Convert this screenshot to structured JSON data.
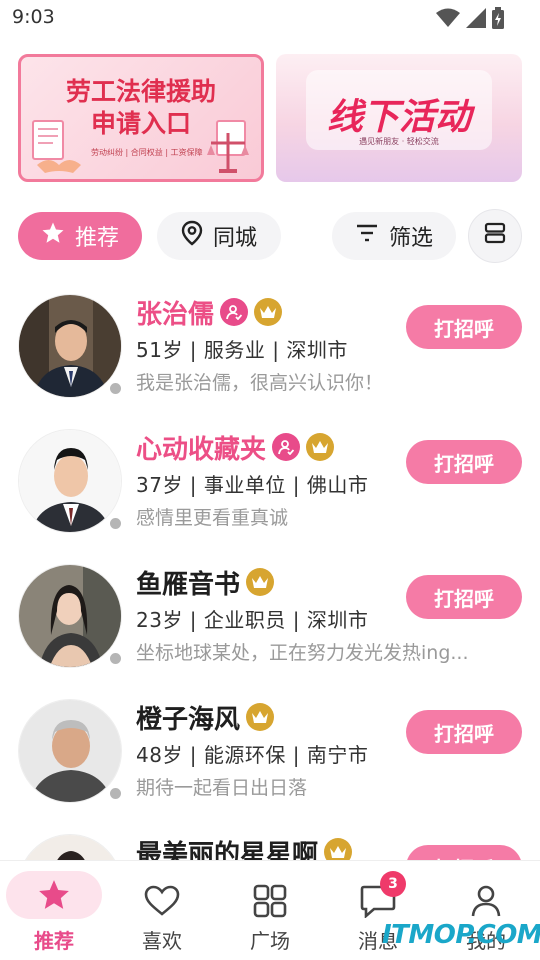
{
  "status_bar": {
    "time": "9:03",
    "icons": [
      "wifi-icon",
      "signal-icon",
      "battery-icon"
    ]
  },
  "banners": [
    {
      "title_line1": "劳工法律援助",
      "title_line2": "申请入口",
      "subtitle": "劳动纠纷 | 合同权益 | 工资保障"
    },
    {
      "title": "线下活动",
      "subtitle": "遇见新朋友 · 轻松交流"
    }
  ],
  "filters": {
    "recommend": "推荐",
    "city": "同城",
    "filter": "筛选"
  },
  "users": [
    {
      "name": "张治儒",
      "info": "51岁 | 服务业 | 深圳市",
      "bio": "我是张治儒，很高兴认识你！",
      "greet": "打招呼",
      "vip_name": true,
      "badges": [
        "verified-user-icon",
        "crown-icon"
      ]
    },
    {
      "name": "心动收藏夹",
      "info": "37岁 | 事业单位 | 佛山市",
      "bio": "感情里更看重真诚",
      "greet": "打招呼",
      "vip_name": true,
      "badges": [
        "verified-user-icon",
        "crown-icon"
      ]
    },
    {
      "name": "鱼雁音书",
      "info": "23岁 | 企业职员 | 深圳市",
      "bio": "坐标地球某处，正在努力发光发热ing...",
      "greet": "打招呼",
      "vip_name": false,
      "badges": [
        "crown-icon"
      ]
    },
    {
      "name": "橙子海风",
      "info": "48岁 | 能源环保 | 南宁市",
      "bio": "期待一起看日出日落",
      "greet": "打招呼",
      "vip_name": false,
      "badges": [
        "crown-icon"
      ]
    },
    {
      "name": "最美丽的星星啊",
      "info": "",
      "bio": "",
      "greet": "打招呼",
      "vip_name": false,
      "badges": [
        "crown-icon"
      ]
    }
  ],
  "tabs": [
    {
      "label": "推荐",
      "icon": "star-icon",
      "active": true
    },
    {
      "label": "喜欢",
      "icon": "heart-icon",
      "active": false
    },
    {
      "label": "广场",
      "icon": "grid-icon",
      "active": false
    },
    {
      "label": "消息",
      "icon": "message-icon",
      "active": false,
      "badge": "3"
    },
    {
      "label": "我的",
      "icon": "person-icon",
      "active": false
    }
  ],
  "watermark": "ITMOP.COM",
  "colors": {
    "accent": "#f06d9d",
    "vip_name": "#ec4f86",
    "crown": "#d7a530",
    "badge_red": "#ef3a6a"
  }
}
